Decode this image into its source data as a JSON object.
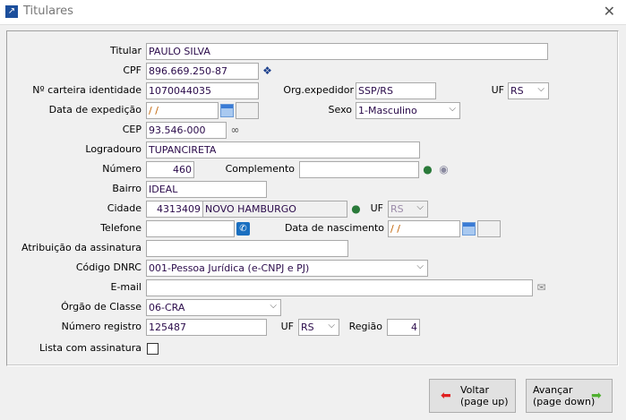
{
  "window": {
    "title": "Titulares",
    "close_glyph": "✕"
  },
  "form": {
    "titular": {
      "label": "Titular",
      "value": "PAULO SILVA"
    },
    "cpf": {
      "label": "CPF",
      "value": "896.669.250-87"
    },
    "carteira": {
      "label": "Nº carteira identidade",
      "value": "1070044035"
    },
    "org_expedidor": {
      "label": "Org.expedidor",
      "value": "SSP/RS"
    },
    "uf_identidade": {
      "label": "UF",
      "value": "RS"
    },
    "data_expedicao": {
      "label": "Data de expedição",
      "value": " /  /"
    },
    "sexo": {
      "label": "Sexo",
      "value": "1-Masculino"
    },
    "cep": {
      "label": "CEP",
      "value": "93.546-000"
    },
    "logradouro": {
      "label": "Logradouro",
      "value": "TUPANCIRETA"
    },
    "numero": {
      "label": "Número",
      "value": "460"
    },
    "complemento": {
      "label": "Complemento",
      "value": ""
    },
    "bairro": {
      "label": "Bairro",
      "value": "IDEAL"
    },
    "cidade": {
      "label": "Cidade",
      "code": "4313409",
      "name": "NOVO HAMBURGO"
    },
    "uf_cidade": {
      "label": "UF",
      "value": "RS"
    },
    "telefone": {
      "label": "Telefone",
      "value": ""
    },
    "data_nascimento": {
      "label": "Data de nascimento",
      "value": " /  /"
    },
    "atribuicao": {
      "label": "Atribuição da assinatura",
      "value": ""
    },
    "codigo_dnrc": {
      "label": "Código DNRC",
      "value": "001-Pessoa Jurídica (e-CNPJ e PJ)"
    },
    "email": {
      "label": "E-mail",
      "value": ""
    },
    "orgao_classe": {
      "label": "Órgão de Classe",
      "value": "06-CRA"
    },
    "numero_registro": {
      "label": "Número registro",
      "value": "125487"
    },
    "uf_registro": {
      "label": "UF",
      "value": "RS"
    },
    "regiao": {
      "label": "Região",
      "value": "4"
    },
    "lista_assinatura": {
      "label": "Lista com assinatura",
      "checked": false
    }
  },
  "buttons": {
    "voltar": {
      "line1": "Voltar",
      "line2": "(page up)",
      "accent": "#e02020"
    },
    "avancar": {
      "line1": "Avançar",
      "line2": "(page down)",
      "accent": "#50b030"
    }
  }
}
